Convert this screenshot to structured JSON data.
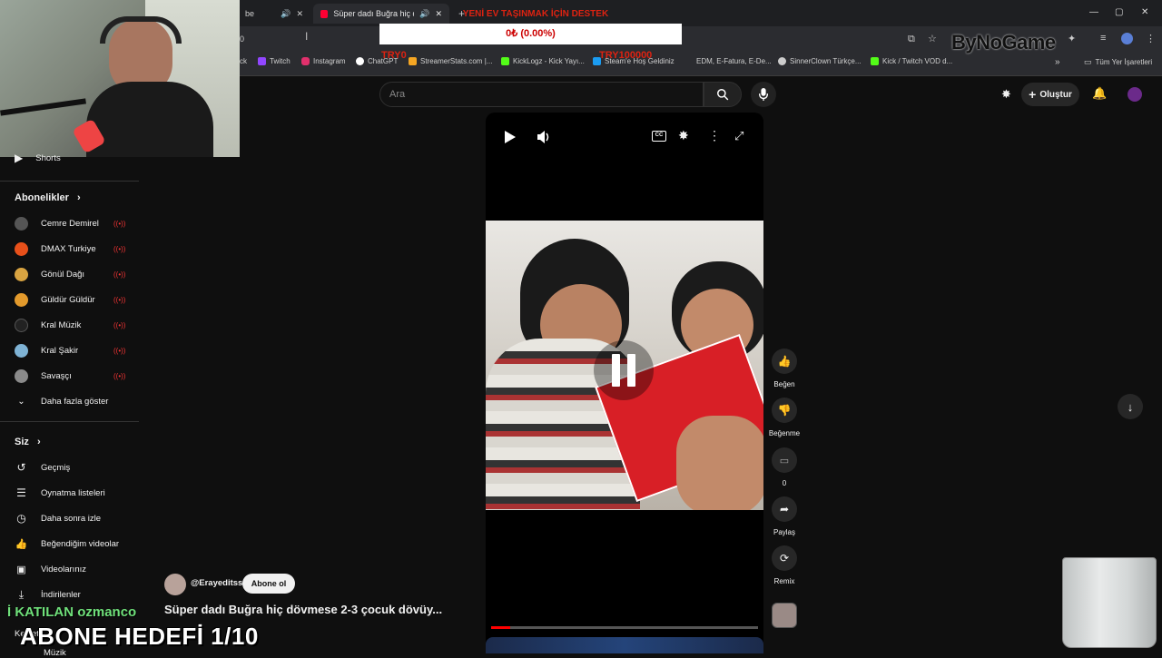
{
  "browser": {
    "tabs": [
      {
        "label": "be"
      },
      {
        "label": "Süper dadı Buğra hiç dövme",
        "active": true
      }
    ],
    "address_fragment": "0",
    "bookmarks": [
      {
        "label": "ck",
        "color": "#888888"
      },
      {
        "label": "Twitch",
        "color": "#9146ff"
      },
      {
        "label": "Instagram",
        "color": "#e1306c"
      },
      {
        "label": "ChatGPT",
        "color": "#ffffff"
      },
      {
        "label": "StreamerStats.com |...",
        "color": "#f5a623"
      },
      {
        "label": "KickLogz - Kick Yayı...",
        "color": "#53fc18"
      },
      {
        "label": "Steam'e Hoş Geldiniz",
        "color": "#1b9cf2"
      },
      {
        "label": "EDM, E-Fatura, E-De...",
        "color": "#cccccc"
      },
      {
        "label": "SinnerClown Türkçe...",
        "color": "#cccccc"
      },
      {
        "label": "Kick / Twitch VOD d...",
        "color": "#53fc18"
      },
      {
        "label": "»",
        "color": ""
      },
      {
        "label": "Tüm Yer İşaretleri",
        "color": "#cccccc"
      }
    ]
  },
  "overlay": {
    "goal_title": "YENİ EV TAŞINMAK İÇİN DESTEK",
    "goal_progress": "0₺ (0.00%)",
    "goal_left": "TRY0",
    "goal_right": "TRY100000",
    "brand": "ByNoGame",
    "katilan": "İ KATILAN ozmanco",
    "abone_hedefi": "ABONE HEDEFİ 1/10"
  },
  "header": {
    "search_placeholder": "Ara",
    "create_label": "Oluştur"
  },
  "sidebar": {
    "shorts_label": "Shorts",
    "subscriptions_title": "Abonelikler",
    "subscriptions": [
      {
        "label": "Cemre Demirel",
        "color": "#555555"
      },
      {
        "label": "DMAX Turkiye",
        "color": "#e8501a"
      },
      {
        "label": "Gönül Dağı",
        "color": "#d9a441"
      },
      {
        "label": "Güldür Güldür",
        "color": "#e39a2c"
      },
      {
        "label": "Kral Müzik",
        "color": "#222222"
      },
      {
        "label": "Kral Şakir",
        "color": "#7fb3d5"
      },
      {
        "label": "Savaşçı",
        "color": "#8a8a8a"
      }
    ],
    "show_more": "Daha fazla göster",
    "you_title": "Siz",
    "you_items": [
      {
        "label": "Geçmiş",
        "icon": "history-icon"
      },
      {
        "label": "Oynatma listeleri",
        "icon": "playlist-icon"
      },
      {
        "label": "Daha sonra izle",
        "icon": "clock-icon"
      },
      {
        "label": "Beğendiğim videolar",
        "icon": "thumbs-up-icon"
      },
      {
        "label": "Videolarınız",
        "icon": "video-icon"
      },
      {
        "label": "İndirilenler",
        "icon": "download-icon"
      }
    ],
    "truncated_items": [
      "Keşfet",
      "Müzik"
    ]
  },
  "video": {
    "channel": "@Erayeditss",
    "subscribe_label": "Abone ol",
    "title": "Süper dadı Buğra hiç dövmese 2-3 çocuk dövüy...",
    "progress": 0.07,
    "actions": {
      "like": "Beğen",
      "dislike": "Beğenme",
      "comments": "0",
      "share": "Paylaş",
      "remix": "Remix"
    }
  }
}
